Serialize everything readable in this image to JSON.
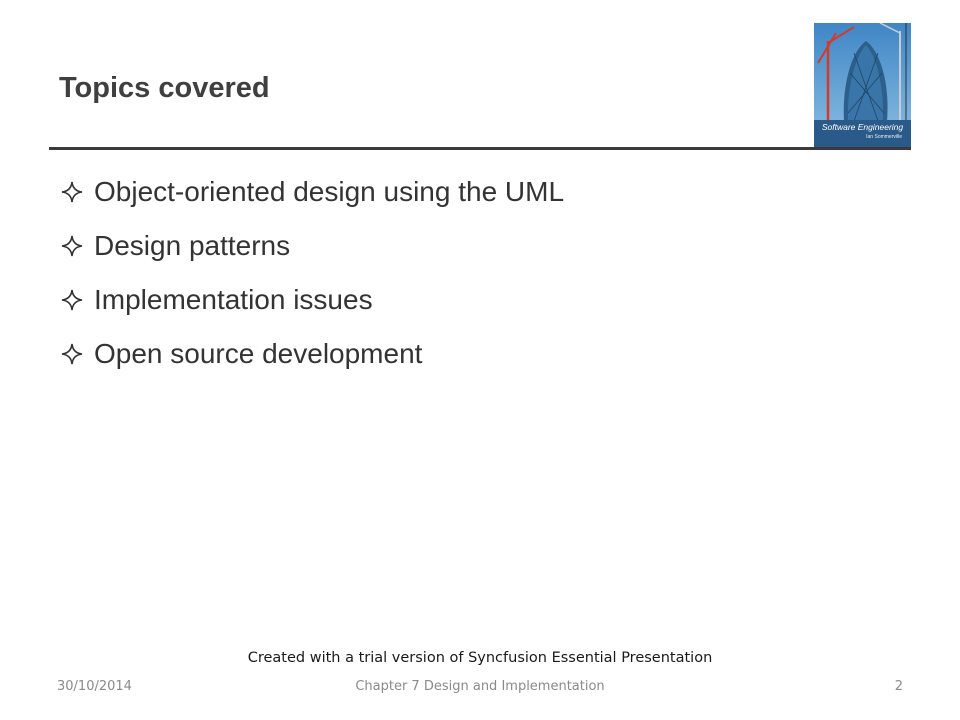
{
  "slide": {
    "title": "Topics covered",
    "bullets": [
      {
        "text": "Object-oriented design using the UML",
        "icon": "four-point-star-icon"
      },
      {
        "text": "Design patterns",
        "icon": "four-point-star-icon"
      },
      {
        "text": "Implementation issues",
        "icon": "four-point-star-icon"
      },
      {
        "text": "Open source development",
        "icon": "four-point-star-icon"
      }
    ]
  },
  "cover": {
    "book_title": "Software Engineering",
    "author": "Ian Sommerville"
  },
  "watermark": "Created with a trial version of Syncfusion Essential Presentation",
  "footer": {
    "date": "30/10/2014",
    "chapter": "Chapter 7 Design and Implementation",
    "page_number": "2"
  },
  "colors": {
    "title_text": "#3f3f3f",
    "body_text": "#333333",
    "footer_text": "#8a8a8a",
    "rule": "#3a3a3a"
  }
}
